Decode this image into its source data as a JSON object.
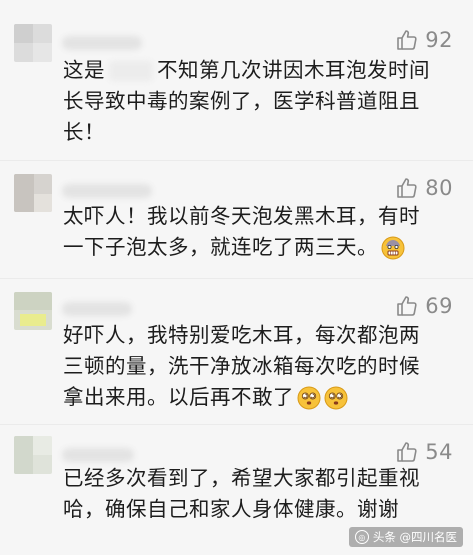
{
  "comments": [
    {
      "likes": "92",
      "lines": [
        "这是",
        "不知第几次讲因木耳泡发时间",
        "长导致中毒的案例了，医学科普道阻且",
        "长！"
      ]
    },
    {
      "likes": "80",
      "lines": [
        "太吓人！我以前冬天泡发黑木耳，有时",
        "一下子泡太多，就连吃了两三天。"
      ]
    },
    {
      "likes": "69",
      "lines": [
        "好吓人，我特别爱吃木耳，每次都泡两",
        "三顿的量，洗干净放冰箱每次吃的时候",
        "拿出来用。以后再不敢了"
      ]
    },
    {
      "likes": "54",
      "lines": [
        "已经多次看到了，希望大家都引起重视",
        "哈，确保自己和家人身体健康。谢谢"
      ]
    }
  ],
  "icons": {
    "like": "thumbs-up-icon",
    "emoji_fear": "fearful-face-emoji",
    "emoji_dizzy": "dizzy-face-emoji"
  },
  "watermark": {
    "label": "头条 @四川名医"
  }
}
